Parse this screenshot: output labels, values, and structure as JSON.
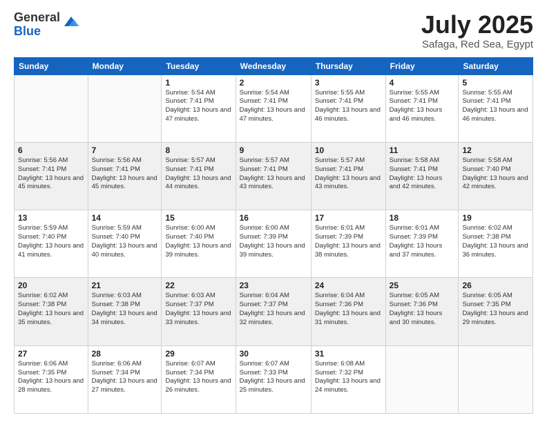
{
  "logo": {
    "general": "General",
    "blue": "Blue"
  },
  "title": {
    "month_year": "July 2025",
    "location": "Safaga, Red Sea, Egypt"
  },
  "weekdays": [
    "Sunday",
    "Monday",
    "Tuesday",
    "Wednesday",
    "Thursday",
    "Friday",
    "Saturday"
  ],
  "weeks": [
    [
      {
        "day": "",
        "info": ""
      },
      {
        "day": "",
        "info": ""
      },
      {
        "day": "1",
        "info": "Sunrise: 5:54 AM\nSunset: 7:41 PM\nDaylight: 13 hours and 47 minutes."
      },
      {
        "day": "2",
        "info": "Sunrise: 5:54 AM\nSunset: 7:41 PM\nDaylight: 13 hours and 47 minutes."
      },
      {
        "day": "3",
        "info": "Sunrise: 5:55 AM\nSunset: 7:41 PM\nDaylight: 13 hours and 46 minutes."
      },
      {
        "day": "4",
        "info": "Sunrise: 5:55 AM\nSunset: 7:41 PM\nDaylight: 13 hours and 46 minutes."
      },
      {
        "day": "5",
        "info": "Sunrise: 5:55 AM\nSunset: 7:41 PM\nDaylight: 13 hours and 46 minutes."
      }
    ],
    [
      {
        "day": "6",
        "info": "Sunrise: 5:56 AM\nSunset: 7:41 PM\nDaylight: 13 hours and 45 minutes."
      },
      {
        "day": "7",
        "info": "Sunrise: 5:56 AM\nSunset: 7:41 PM\nDaylight: 13 hours and 45 minutes."
      },
      {
        "day": "8",
        "info": "Sunrise: 5:57 AM\nSunset: 7:41 PM\nDaylight: 13 hours and 44 minutes."
      },
      {
        "day": "9",
        "info": "Sunrise: 5:57 AM\nSunset: 7:41 PM\nDaylight: 13 hours and 43 minutes."
      },
      {
        "day": "10",
        "info": "Sunrise: 5:57 AM\nSunset: 7:41 PM\nDaylight: 13 hours and 43 minutes."
      },
      {
        "day": "11",
        "info": "Sunrise: 5:58 AM\nSunset: 7:41 PM\nDaylight: 13 hours and 42 minutes."
      },
      {
        "day": "12",
        "info": "Sunrise: 5:58 AM\nSunset: 7:40 PM\nDaylight: 13 hours and 42 minutes."
      }
    ],
    [
      {
        "day": "13",
        "info": "Sunrise: 5:59 AM\nSunset: 7:40 PM\nDaylight: 13 hours and 41 minutes."
      },
      {
        "day": "14",
        "info": "Sunrise: 5:59 AM\nSunset: 7:40 PM\nDaylight: 13 hours and 40 minutes."
      },
      {
        "day": "15",
        "info": "Sunrise: 6:00 AM\nSunset: 7:40 PM\nDaylight: 13 hours and 39 minutes."
      },
      {
        "day": "16",
        "info": "Sunrise: 6:00 AM\nSunset: 7:39 PM\nDaylight: 13 hours and 39 minutes."
      },
      {
        "day": "17",
        "info": "Sunrise: 6:01 AM\nSunset: 7:39 PM\nDaylight: 13 hours and 38 minutes."
      },
      {
        "day": "18",
        "info": "Sunrise: 6:01 AM\nSunset: 7:39 PM\nDaylight: 13 hours and 37 minutes."
      },
      {
        "day": "19",
        "info": "Sunrise: 6:02 AM\nSunset: 7:38 PM\nDaylight: 13 hours and 36 minutes."
      }
    ],
    [
      {
        "day": "20",
        "info": "Sunrise: 6:02 AM\nSunset: 7:38 PM\nDaylight: 13 hours and 35 minutes."
      },
      {
        "day": "21",
        "info": "Sunrise: 6:03 AM\nSunset: 7:38 PM\nDaylight: 13 hours and 34 minutes."
      },
      {
        "day": "22",
        "info": "Sunrise: 6:03 AM\nSunset: 7:37 PM\nDaylight: 13 hours and 33 minutes."
      },
      {
        "day": "23",
        "info": "Sunrise: 6:04 AM\nSunset: 7:37 PM\nDaylight: 13 hours and 32 minutes."
      },
      {
        "day": "24",
        "info": "Sunrise: 6:04 AM\nSunset: 7:36 PM\nDaylight: 13 hours and 31 minutes."
      },
      {
        "day": "25",
        "info": "Sunrise: 6:05 AM\nSunset: 7:36 PM\nDaylight: 13 hours and 30 minutes."
      },
      {
        "day": "26",
        "info": "Sunrise: 6:05 AM\nSunset: 7:35 PM\nDaylight: 13 hours and 29 minutes."
      }
    ],
    [
      {
        "day": "27",
        "info": "Sunrise: 6:06 AM\nSunset: 7:35 PM\nDaylight: 13 hours and 28 minutes."
      },
      {
        "day": "28",
        "info": "Sunrise: 6:06 AM\nSunset: 7:34 PM\nDaylight: 13 hours and 27 minutes."
      },
      {
        "day": "29",
        "info": "Sunrise: 6:07 AM\nSunset: 7:34 PM\nDaylight: 13 hours and 26 minutes."
      },
      {
        "day": "30",
        "info": "Sunrise: 6:07 AM\nSunset: 7:33 PM\nDaylight: 13 hours and 25 minutes."
      },
      {
        "day": "31",
        "info": "Sunrise: 6:08 AM\nSunset: 7:32 PM\nDaylight: 13 hours and 24 minutes."
      },
      {
        "day": "",
        "info": ""
      },
      {
        "day": "",
        "info": ""
      }
    ]
  ]
}
